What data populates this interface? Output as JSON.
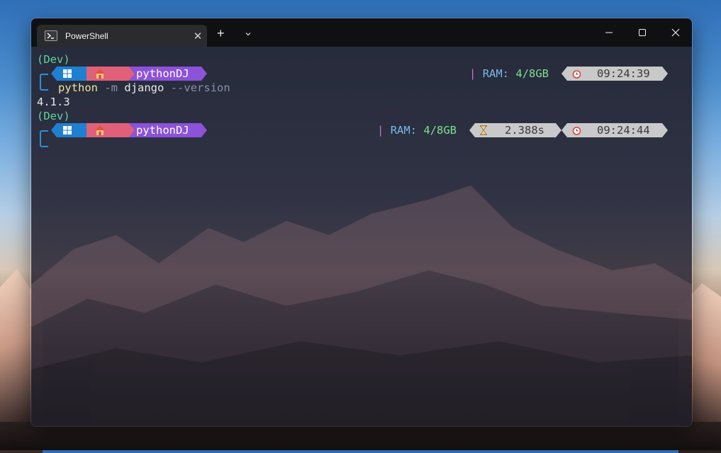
{
  "window": {
    "tab_title": "PowerShell",
    "tab_close_glyph": "✕",
    "new_tab_glyph": "+",
    "accent": "#2d8fd6"
  },
  "terminal": {
    "prompt1": {
      "venv": "(Dev)",
      "path": "pythonDJ",
      "ram_sep": "|",
      "ram_label": "RAM:",
      "ram_value": "4/8GB",
      "time": "09:24:39"
    },
    "command": {
      "exe": "python",
      "flag": "-m",
      "arg": "django",
      "option": "--version"
    },
    "output": "4.1.3",
    "prompt2": {
      "venv": "(Dev)",
      "path": "pythonDJ",
      "ram_sep": "|",
      "ram_label": "RAM:",
      "ram_value": "4/8GB",
      "duration": "2.388s",
      "time": "09:24:44"
    }
  },
  "icons": [
    "powershell-icon",
    "close-icon",
    "plus-icon",
    "chevron-down-icon",
    "minimize-icon",
    "maximize-icon",
    "close-window-icon",
    "windows-icon",
    "home-icon",
    "hourglass-icon",
    "alarm-clock-icon"
  ],
  "colors": {
    "os_segment": "#1f7fd0",
    "home_segment": "#e0607a",
    "path_segment": "#8c52d9",
    "pill": "#c9c9c9",
    "venv": "#5fd5a0",
    "ram_value": "#7ee08f"
  }
}
